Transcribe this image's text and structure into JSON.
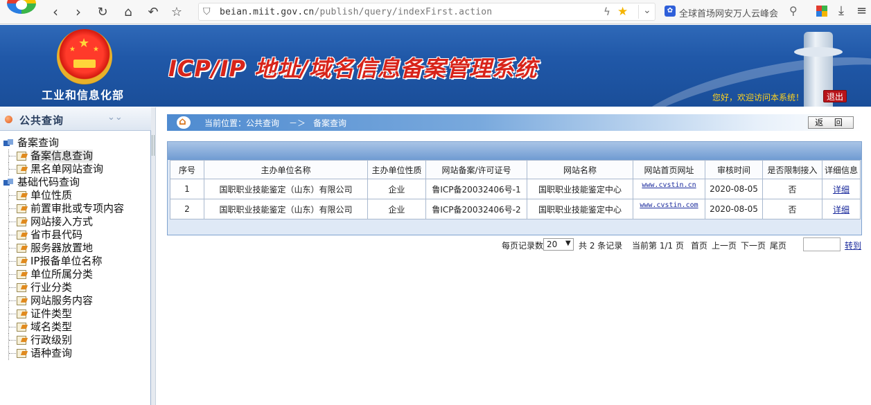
{
  "browser": {
    "url_host": "beian.miit.gov.cn",
    "url_path": "/publish/query/indexFirst.action",
    "search_text": "全球首场网安万人云峰会"
  },
  "header": {
    "ministry": "工业和信息化部",
    "title": "ICP/IP 地址/域名信息备案管理系统",
    "welcome": "您好，欢迎访问本系统！",
    "logout": "退出"
  },
  "sidebar": {
    "title": "公共查询",
    "groups": [
      {
        "label": "备案查询",
        "items": [
          "备案信息查询",
          "黑名单网站查询"
        ]
      },
      {
        "label": "基础代码查询",
        "items": [
          "单位性质",
          "前置审批或专项内容",
          "网站接入方式",
          "省市县代码",
          "服务器放置地",
          "IP报备单位名称",
          "单位所属分类",
          "行业分类",
          "网站服务内容",
          "证件类型",
          "域名类型",
          "行政级别",
          "语种查询"
        ]
      }
    ]
  },
  "breadcrumb": {
    "prefix": "当前位置：公共查询",
    "arrow": "－＞",
    "current": "备案查询"
  },
  "back_button": "返 回",
  "table": {
    "headers": [
      "序号",
      "主办单位名称",
      "主办单位性质",
      "网站备案/许可证号",
      "网站名称",
      "网站首页网址",
      "审核时间",
      "是否限制接入",
      "详细信息"
    ],
    "rows": [
      [
        "1",
        "国职职业技能鉴定（山东）有限公司",
        "企业",
        "鲁ICP备20032406号-1",
        "国职职业技能鉴定中心",
        "www.cvstin.cn",
        "2020-08-05",
        "否",
        "详细"
      ],
      [
        "2",
        "国职职业技能鉴定（山东）有限公司",
        "企业",
        "鲁ICP备20032406号-2",
        "国职职业技能鉴定中心",
        "www.cvstin.com",
        "2020-08-05",
        "否",
        "详细"
      ]
    ]
  },
  "pager": {
    "per_page_label": "每页记录数",
    "per_page": "20",
    "total": "共 2 条记录",
    "current": "当前第 1/1 页",
    "first": "首页",
    "prev": "上一页",
    "next": "下一页",
    "last": "尾页",
    "goto": "转到"
  }
}
